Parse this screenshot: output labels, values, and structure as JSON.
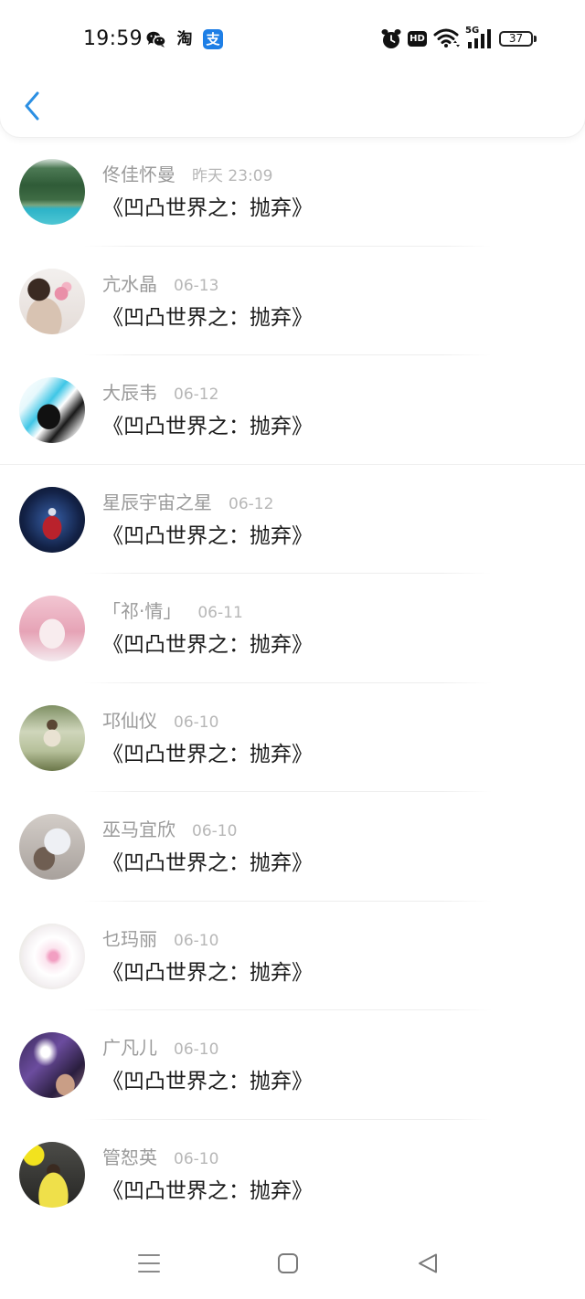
{
  "status_bar": {
    "time": "19:59",
    "app_icons": [
      {
        "icon": "wechat-icon"
      },
      {
        "icon": "taobao-icon",
        "text": "淘"
      },
      {
        "icon": "alipay-icon",
        "text": "支"
      }
    ],
    "alarm_icon": "alarm-icon",
    "hd_label": "HD",
    "wifi_icon": "wifi-icon",
    "network_label": "5G",
    "signal_icon": "signal-icon",
    "battery_level": "37"
  },
  "header": {
    "back_icon": "chevron-left-icon"
  },
  "list": [
    {
      "name": "佟佳怀曼",
      "date": "昨天 23:09",
      "title": "《凹凸世界之：抛弃》"
    },
    {
      "name": "亢水晶",
      "date": "06-13",
      "title": "《凹凸世界之：抛弃》"
    },
    {
      "name": "大辰韦",
      "date": "06-12",
      "title": "《凹凸世界之：抛弃》"
    },
    {
      "name": "星辰宇宙之星",
      "date": "06-12",
      "title": "《凹凸世界之：抛弃》"
    },
    {
      "name": "「祁·情」",
      "date": "06-11",
      "title": "《凹凸世界之：抛弃》"
    },
    {
      "name": "邛仙仪",
      "date": "06-10",
      "title": "《凹凸世界之：抛弃》"
    },
    {
      "name": "巫马宜欣",
      "date": "06-10",
      "title": "《凹凸世界之：抛弃》"
    },
    {
      "name": "乜玛丽",
      "date": "06-10",
      "title": "《凹凸世界之：抛弃》"
    },
    {
      "name": "广凡儿",
      "date": "06-10",
      "title": "《凹凸世界之：抛弃》"
    },
    {
      "name": "管恕英",
      "date": "06-10",
      "title": "《凹凸世界之：抛弃》"
    }
  ],
  "nav_bar": {
    "menu_icon": "menu-icon",
    "home_icon": "square-icon",
    "back_icon": "triangle-back-icon"
  },
  "colors": {
    "accent": "#2b8fe3",
    "name": "#9a9a9a",
    "date": "#b7b7b7",
    "title": "#1b1b1b"
  }
}
